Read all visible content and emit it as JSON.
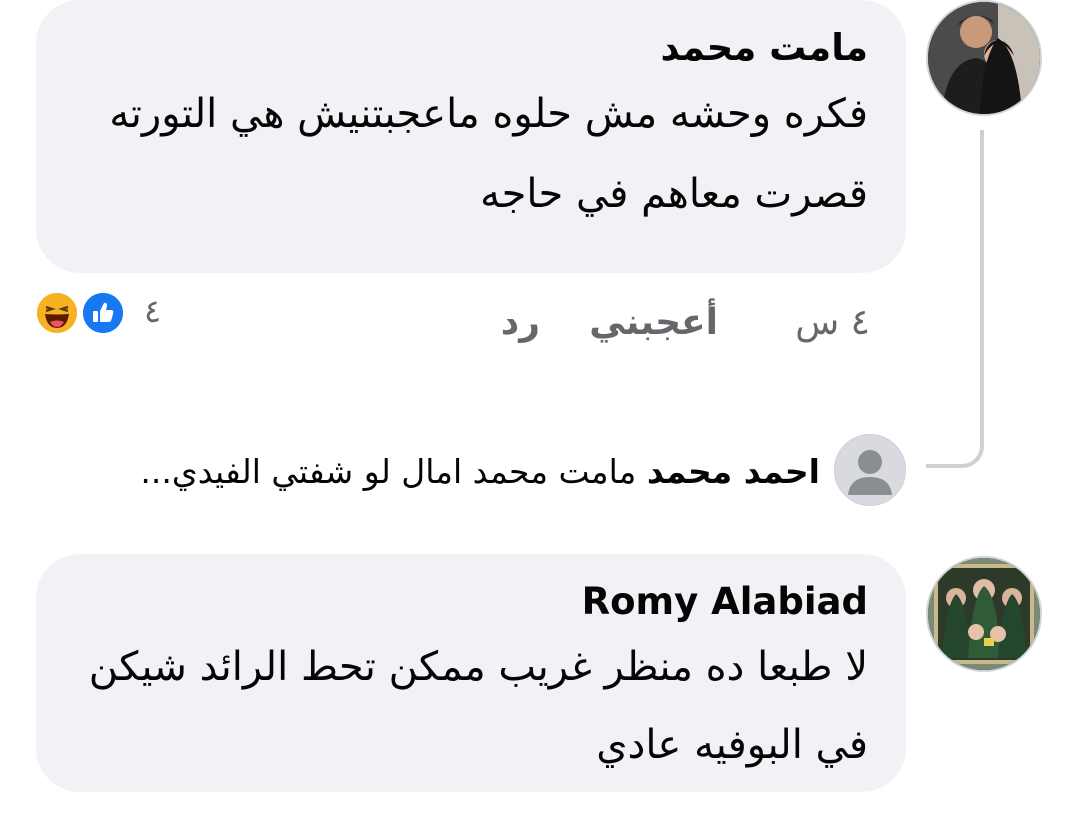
{
  "comments": [
    {
      "author": "مامت محمد",
      "text": "فكره وحشه مش حلوه ماعجبتنيش هي التورته قصرت معاهم في حاجه",
      "time": "٤ س",
      "like_label": "أعجبني",
      "reply_label": "رد",
      "reaction_count": "٤",
      "reactions": [
        "like-icon",
        "haha-icon"
      ]
    },
    {
      "author": "Romy Alabiad",
      "text": "لا طبعا ده منظر غريب ممكن تحط الرائد شيكن في البوفيه عادي"
    }
  ],
  "reply_preview": {
    "author": "احمد محمد",
    "text": "مامت محمد امال لو شفتي الفيدي..."
  },
  "colors": {
    "bubble": "#f0f2f5",
    "secondary_text": "#65676b",
    "like_blue": "#1877f2",
    "haha_yellow": "#f7b125"
  }
}
